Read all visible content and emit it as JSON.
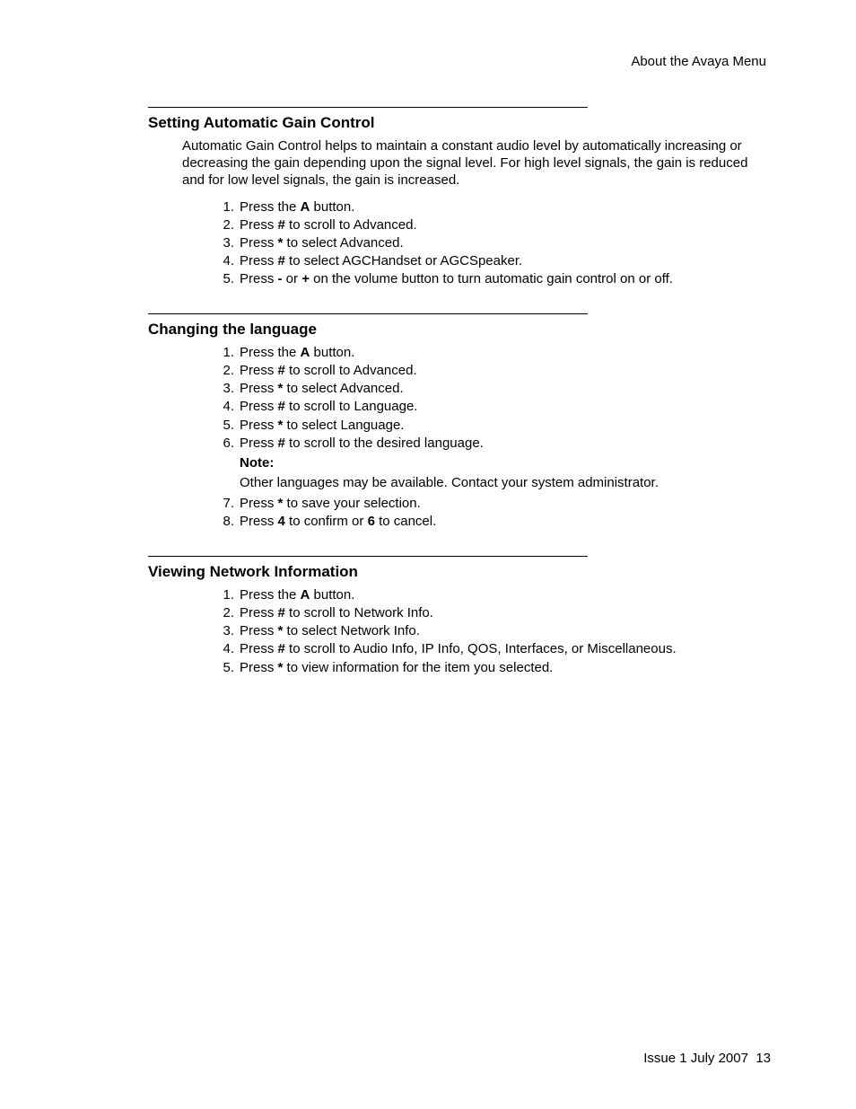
{
  "header": {
    "text": "About the Avaya Menu"
  },
  "sections": [
    {
      "heading": "Setting Automatic Gain Control",
      "intro": "Automatic Gain Control helps to maintain a constant audio level by automatically increasing or decreasing the gain depending upon the signal level. For high level signals, the gain is reduced and for low level signals, the gain is increased.",
      "steps": [
        {
          "segments": [
            {
              "t": "Press the "
            },
            {
              "t": "A",
              "b": true
            },
            {
              "t": " button."
            }
          ]
        },
        {
          "segments": [
            {
              "t": "Press "
            },
            {
              "t": "#",
              "b": true
            },
            {
              "t": " to scroll to Advanced."
            }
          ]
        },
        {
          "segments": [
            {
              "t": "Press "
            },
            {
              "t": "*",
              "b": true
            },
            {
              "t": " to select Advanced."
            }
          ]
        },
        {
          "segments": [
            {
              "t": "Press "
            },
            {
              "t": "#",
              "b": true
            },
            {
              "t": " to select AGCHandset or AGCSpeaker."
            }
          ]
        },
        {
          "segments": [
            {
              "t": "Press "
            },
            {
              "t": "-",
              "b": true
            },
            {
              "t": " or "
            },
            {
              "t": "+",
              "b": true
            },
            {
              "t": " on the volume button to turn automatic gain control on or off."
            }
          ]
        }
      ]
    },
    {
      "heading": "Changing the language",
      "steps": [
        {
          "segments": [
            {
              "t": "Press the "
            },
            {
              "t": "A",
              "b": true
            },
            {
              "t": " button."
            }
          ]
        },
        {
          "segments": [
            {
              "t": "Press "
            },
            {
              "t": "#",
              "b": true
            },
            {
              "t": " to scroll to Advanced."
            }
          ]
        },
        {
          "segments": [
            {
              "t": "Press "
            },
            {
              "t": "*",
              "b": true
            },
            {
              "t": " to select Advanced."
            }
          ]
        },
        {
          "segments": [
            {
              "t": "Press "
            },
            {
              "t": "#",
              "b": true
            },
            {
              "t": " to scroll to Language."
            }
          ]
        },
        {
          "segments": [
            {
              "t": "Press "
            },
            {
              "t": "*",
              "b": true
            },
            {
              "t": " to select Language."
            }
          ]
        },
        {
          "segments": [
            {
              "t": "Press "
            },
            {
              "t": "#",
              "b": true
            },
            {
              "t": " to scroll to the desired language."
            }
          ],
          "note": {
            "label": "Note:",
            "body": "Other languages may be available. Contact your system administrator."
          }
        },
        {
          "segments": [
            {
              "t": "Press "
            },
            {
              "t": "*",
              "b": true
            },
            {
              "t": " to save your selection."
            }
          ]
        },
        {
          "segments": [
            {
              "t": "Press "
            },
            {
              "t": "4",
              "b": true
            },
            {
              "t": " to confirm or "
            },
            {
              "t": "6",
              "b": true
            },
            {
              "t": " to cancel."
            }
          ]
        }
      ]
    },
    {
      "heading": "Viewing Network Information",
      "steps": [
        {
          "segments": [
            {
              "t": "Press the "
            },
            {
              "t": "A",
              "b": true
            },
            {
              "t": " button."
            }
          ]
        },
        {
          "segments": [
            {
              "t": "Press "
            },
            {
              "t": "#",
              "b": true
            },
            {
              "t": " to scroll to Network Info."
            }
          ]
        },
        {
          "segments": [
            {
              "t": "Press "
            },
            {
              "t": "*",
              "b": true
            },
            {
              "t": " to select Network Info."
            }
          ]
        },
        {
          "segments": [
            {
              "t": "Press "
            },
            {
              "t": "#",
              "b": true
            },
            {
              "t": " to scroll to Audio Info, IP Info, QOS, Interfaces, or Miscellaneous."
            }
          ]
        },
        {
          "segments": [
            {
              "t": "Press "
            },
            {
              "t": "*",
              "b": true
            },
            {
              "t": " to view information for the item you selected."
            }
          ]
        }
      ]
    }
  ],
  "footer": {
    "issue": "Issue 1 July 2007",
    "page": "13"
  }
}
